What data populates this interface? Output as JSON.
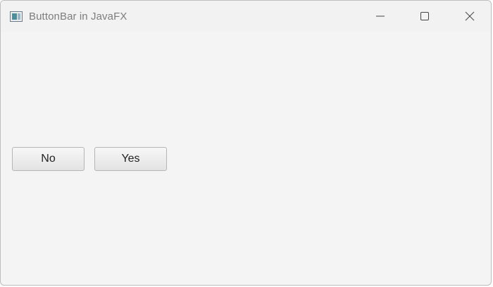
{
  "window": {
    "title": "ButtonBar in JavaFX",
    "app_icon": "javafx-window-icon",
    "controls": {
      "minimize_icon": "minimize-icon",
      "maximize_icon": "maximize-icon",
      "close_icon": "close-icon"
    }
  },
  "button_bar": {
    "buttons": [
      {
        "label": "No"
      },
      {
        "label": "Yes"
      }
    ]
  },
  "colors": {
    "window_background": "#f4f4f4",
    "title_text": "#7d7d7d",
    "button_border": "#b5b5b5"
  }
}
